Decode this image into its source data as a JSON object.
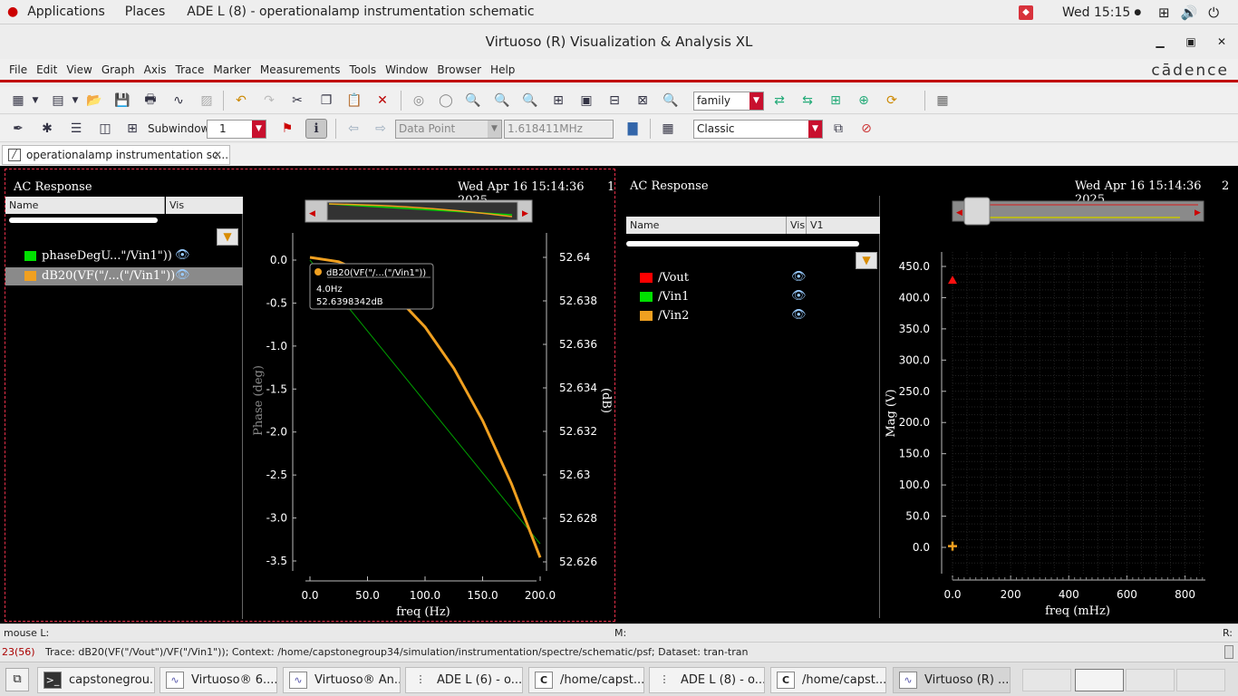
{
  "top_panel": {
    "applications": "Applications",
    "places": "Places",
    "active_window": "ADE L (8) - operationalamp instrumentation schematic",
    "clock": "Wed 15:15"
  },
  "window": {
    "title": "Virtuoso (R) Visualization & Analysis XL"
  },
  "menu": {
    "items": [
      "File",
      "Edit",
      "View",
      "Graph",
      "Axis",
      "Trace",
      "Marker",
      "Measurements",
      "Tools",
      "Window",
      "Browser",
      "Help"
    ],
    "brand": "cādence"
  },
  "toolbar1": {
    "family_value": "family"
  },
  "toolbar2": {
    "subwindow_label": "Subwindow:",
    "subwindow_value": "1",
    "marker_mode": "Data Point",
    "marker_value": "1.618411MHz",
    "style_value": "Classic"
  },
  "tabs": [
    {
      "label": "operationalamp instrumentation sc..."
    }
  ],
  "subwindow1": {
    "title": "AC Response",
    "timestamp": "Wed Apr 16 15:14:36 2025",
    "number": "1",
    "legend_columns": [
      "Name",
      "Vis"
    ],
    "traces": [
      {
        "name": "phaseDegU...\"/Vin1\"))",
        "color": "#00e000"
      },
      {
        "name": "dB20(VF(\"/...(\"/Vin1\"))",
        "color": "#f0a020"
      }
    ],
    "marker": {
      "title": "dB20(VF(\"/...(\"/Vin1\"))",
      "x": "4.0Hz",
      "y": "52.6398342dB"
    },
    "xlabel": "freq (Hz)",
    "ylabel_left": "Phase (deg)",
    "ylabel_right": "(dB)"
  },
  "subwindow2": {
    "title": "AC Response",
    "timestamp": "Wed Apr 16 15:14:36 2025",
    "number": "2",
    "legend_columns": [
      "Name",
      "Vis",
      "V1"
    ],
    "traces": [
      {
        "name": "/Vout",
        "color": "#ff0000"
      },
      {
        "name": "/Vin1",
        "color": "#00e000"
      },
      {
        "name": "/Vin2",
        "color": "#f0a020"
      }
    ],
    "xlabel": "freq (mHz)",
    "ylabel": "Mag (V)"
  },
  "chart_data": [
    {
      "type": "line",
      "title": "AC Response",
      "xlabel": "freq (Hz)",
      "xlim": [
        0,
        200
      ],
      "x_ticks": [
        "0.0",
        "50.0",
        "100.0",
        "150.0",
        "200.0"
      ],
      "y_left": {
        "label": "Phase (deg)",
        "ylim": [
          -3.5,
          0
        ],
        "ticks": [
          "0.0",
          "-0.5",
          "-1.0",
          "-1.5",
          "-2.0",
          "-2.5",
          "-3.0",
          "-3.5"
        ]
      },
      "y_right": {
        "label": "(dB)",
        "ylim": [
          52.626,
          52.64
        ],
        "ticks": [
          "52.64",
          "52.638",
          "52.636",
          "52.634",
          "52.632",
          "52.63",
          "52.628",
          "52.626"
        ]
      },
      "series": [
        {
          "name": "phaseDegU...\"/Vin1\"))",
          "axis": "left",
          "x": [
            0,
            200
          ],
          "y": [
            0,
            -3.3
          ]
        },
        {
          "name": "dB20(VF(\"/...(\"/Vin1\"))",
          "axis": "right",
          "x": [
            0,
            25,
            50,
            75,
            100,
            125,
            150,
            175,
            200
          ],
          "y": [
            52.64,
            52.6398,
            52.6392,
            52.6382,
            52.6368,
            52.6349,
            52.6325,
            52.6296,
            52.6262
          ]
        }
      ]
    },
    {
      "type": "scatter",
      "title": "AC Response",
      "xlabel": "freq (mHz)",
      "ylabel": "Mag (V)",
      "xlim": [
        0,
        870
      ],
      "ylim": [
        -40,
        470
      ],
      "x_ticks": [
        "0.0",
        "200",
        "400",
        "600",
        "800"
      ],
      "y_ticks": [
        "450.0",
        "400.0",
        "350.0",
        "300.0",
        "250.0",
        "200.0",
        "150.0",
        "100.0",
        "50.0",
        "0.0"
      ],
      "series": [
        {
          "name": "/Vout",
          "x": [
            0
          ],
          "y": [
            428
          ]
        },
        {
          "name": "/Vin2",
          "x": [
            0
          ],
          "y": [
            2
          ]
        }
      ]
    }
  ],
  "status": {
    "mouse": "mouse L:",
    "m": "M:",
    "r": "R:",
    "counter": "23(56)",
    "message": "Trace: dB20(VF(\"/Vout\")/VF(\"/Vin1\")); Context: /home/capstonegroup34/simulation/instrumentation/spectre/schematic/psf; Dataset: tran-tran"
  },
  "taskbar": {
    "tasks": [
      "capstonegrou...",
      "Virtuoso® 6....",
      "Virtuoso® An...",
      "ADE L (6) - o...",
      "/home/capst...",
      "ADE L (8) - o...",
      "/home/capst...",
      "Virtuoso (R) ..."
    ]
  }
}
